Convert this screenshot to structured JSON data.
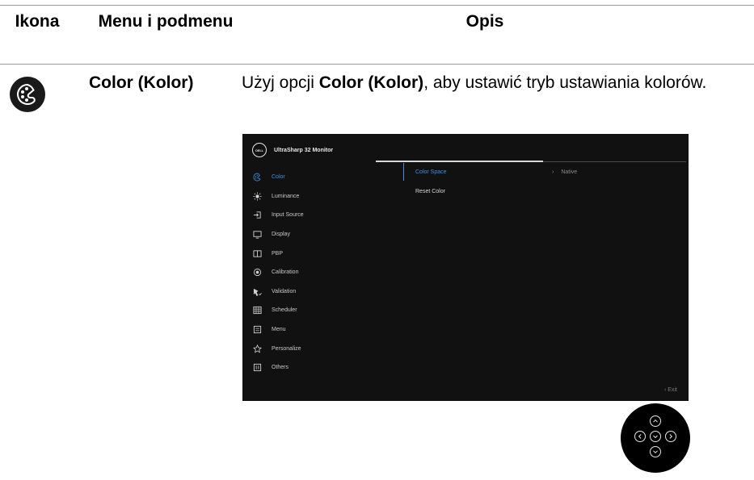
{
  "table": {
    "headers": {
      "icon": "Ikona",
      "menu": "Menu i podmenu",
      "description": "Opis"
    },
    "row": {
      "menu": "Color (Kolor)",
      "desc_prefix": "Użyj opcji ",
      "desc_bold": "Color (Kolor)",
      "desc_suffix": ", aby ustawić tryb ustawiania kolorów."
    }
  },
  "osd": {
    "brand_logo": "DELL",
    "title": "UltraSharp 32 Monitor",
    "menu_items": [
      {
        "label": "Color",
        "icon": "palette-icon",
        "active": true
      },
      {
        "label": "Luminance",
        "icon": "brightness-icon",
        "active": false
      },
      {
        "label": "Input Source",
        "icon": "input-source-icon",
        "active": false
      },
      {
        "label": "Display",
        "icon": "display-icon",
        "active": false
      },
      {
        "label": "PBP",
        "icon": "pbp-icon",
        "active": false
      },
      {
        "label": "Calibration",
        "icon": "calibration-icon",
        "active": false
      },
      {
        "label": "Validation",
        "icon": "validation-icon",
        "active": false
      },
      {
        "label": "Scheduler",
        "icon": "scheduler-icon",
        "active": false
      },
      {
        "label": "Menu",
        "icon": "menu-icon",
        "active": false
      },
      {
        "label": "Personalize",
        "icon": "star-icon",
        "active": false
      },
      {
        "label": "Others",
        "icon": "others-icon",
        "active": false
      }
    ],
    "submenu": {
      "item1": "Color Space",
      "item2": "Reset Color",
      "value": "Native"
    },
    "exit_label": "Exit",
    "accent_color": "#3c90e6",
    "background_color": "#111111"
  },
  "joystick": {
    "buttons": [
      "up-icon",
      "left-icon",
      "ok-icon",
      "right-icon",
      "down-icon"
    ]
  }
}
